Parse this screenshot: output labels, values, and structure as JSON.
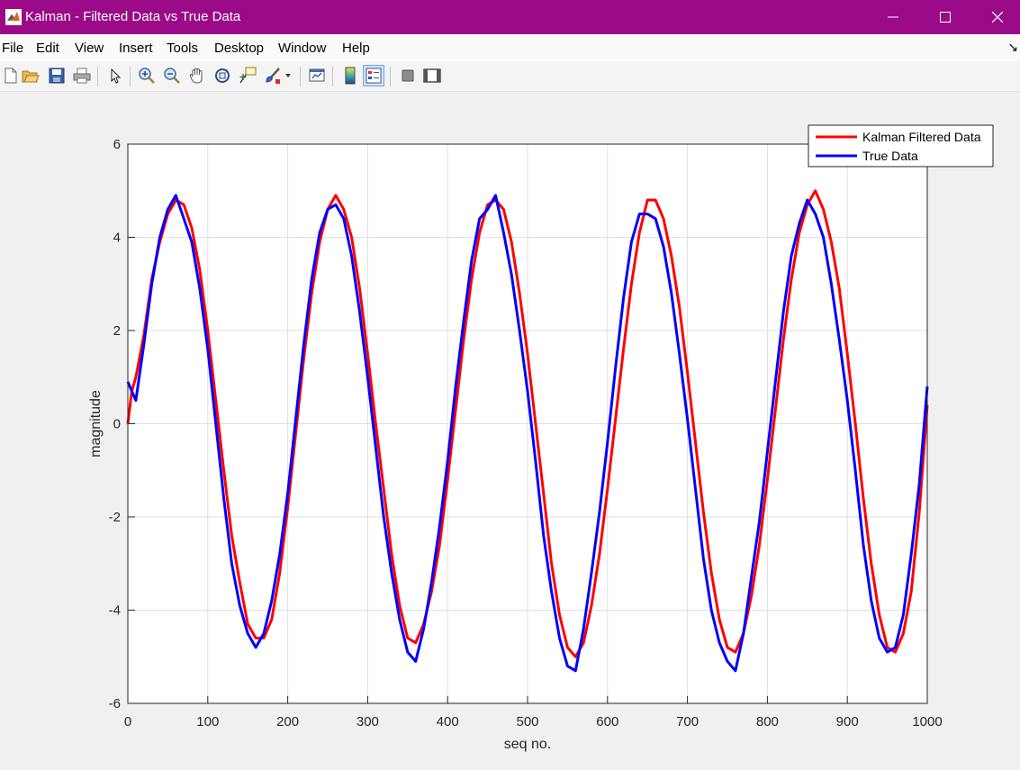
{
  "window": {
    "title": "Kalman - Filtered Data vs True Data",
    "titlebar_color": "#9b0a87",
    "controls": [
      "minimize-icon",
      "maximize-icon",
      "close-icon"
    ]
  },
  "menu": {
    "items": [
      "File",
      "Edit",
      "View",
      "Insert",
      "Tools",
      "Desktop",
      "Window",
      "Help"
    ]
  },
  "toolbar": {
    "icons": [
      "new-figure-icon",
      "open-file-icon",
      "save-icon",
      "print-icon",
      "select-pointer-icon",
      "zoom-in-icon",
      "zoom-out-icon",
      "pan-hand-icon",
      "rotate-3d-icon",
      "data-cursor-icon",
      "brush-icon",
      "link-plot-icon",
      "colorbar-icon",
      "legend-icon",
      "hide-plot-tools-icon",
      "show-plot-tools-icon"
    ]
  },
  "chart_data": {
    "type": "line",
    "title": "",
    "xlabel": "seq no.",
    "ylabel": "magnitude",
    "xlim": [
      0,
      1000
    ],
    "ylim": [
      -6,
      6
    ],
    "xticks": [
      0,
      100,
      200,
      300,
      400,
      500,
      600,
      700,
      800,
      900,
      1000
    ],
    "yticks": [
      -6,
      -4,
      -2,
      0,
      2,
      4,
      6
    ],
    "grid": true,
    "legend_position": "top-right",
    "series": [
      {
        "name": "Kalman Filtered Data",
        "color": "#ff0000",
        "x": [
          0,
          5,
          10,
          20,
          30,
          40,
          50,
          60,
          70,
          80,
          90,
          100,
          110,
          120,
          130,
          140,
          150,
          160,
          170,
          180,
          190,
          200,
          210,
          220,
          230,
          240,
          250,
          260,
          270,
          280,
          290,
          300,
          310,
          320,
          330,
          340,
          350,
          360,
          370,
          380,
          390,
          400,
          410,
          420,
          430,
          440,
          450,
          460,
          470,
          480,
          490,
          500,
          510,
          520,
          530,
          540,
          550,
          560,
          570,
          580,
          590,
          600,
          610,
          620,
          630,
          640,
          650,
          660,
          670,
          680,
          690,
          700,
          710,
          720,
          730,
          740,
          750,
          760,
          770,
          780,
          790,
          800,
          810,
          820,
          830,
          840,
          850,
          860,
          870,
          880,
          890,
          900,
          910,
          920,
          930,
          940,
          950,
          960,
          970,
          980,
          990,
          1000
        ],
        "y": [
          0.0,
          0.7,
          1.0,
          1.9,
          3.1,
          3.9,
          4.5,
          4.8,
          4.7,
          4.2,
          3.3,
          2.0,
          0.5,
          -1.0,
          -2.4,
          -3.4,
          -4.3,
          -4.6,
          -4.6,
          -4.2,
          -3.2,
          -1.8,
          -0.2,
          1.4,
          2.8,
          3.9,
          4.6,
          4.9,
          4.6,
          4.0,
          2.9,
          1.5,
          0.0,
          -1.4,
          -2.8,
          -3.9,
          -4.6,
          -4.7,
          -4.3,
          -3.6,
          -2.6,
          -1.2,
          0.3,
          1.8,
          3.1,
          4.1,
          4.7,
          4.8,
          4.6,
          3.9,
          2.8,
          1.5,
          0.0,
          -1.5,
          -3.0,
          -4.1,
          -4.8,
          -5.0,
          -4.7,
          -3.9,
          -2.8,
          -1.4,
          0.1,
          1.6,
          3.0,
          4.1,
          4.8,
          4.8,
          4.4,
          3.6,
          2.5,
          1.1,
          -0.4,
          -1.9,
          -3.2,
          -4.2,
          -4.8,
          -4.9,
          -4.5,
          -3.7,
          -2.6,
          -1.2,
          0.3,
          1.8,
          3.1,
          4.1,
          4.7,
          5.0,
          4.6,
          3.9,
          2.9,
          1.5,
          0.0,
          -1.6,
          -3.0,
          -4.1,
          -4.8,
          -4.9,
          -4.5,
          -3.6,
          -1.9,
          0.4
        ]
      },
      {
        "name": "True Data",
        "color": "#0000ff",
        "x": [
          0,
          5,
          10,
          20,
          30,
          40,
          50,
          60,
          70,
          80,
          90,
          100,
          110,
          120,
          130,
          140,
          150,
          160,
          170,
          180,
          190,
          200,
          210,
          220,
          230,
          240,
          250,
          260,
          270,
          280,
          290,
          300,
          310,
          320,
          330,
          340,
          350,
          360,
          370,
          380,
          390,
          400,
          410,
          420,
          430,
          440,
          450,
          460,
          470,
          480,
          490,
          500,
          510,
          520,
          530,
          540,
          550,
          560,
          570,
          580,
          590,
          600,
          610,
          620,
          630,
          640,
          650,
          660,
          670,
          680,
          690,
          700,
          710,
          720,
          730,
          740,
          750,
          760,
          770,
          780,
          790,
          800,
          810,
          820,
          830,
          840,
          850,
          860,
          870,
          880,
          890,
          900,
          910,
          920,
          930,
          940,
          950,
          960,
          970,
          980,
          990,
          1000
        ],
        "y": [
          0.9,
          0.7,
          0.5,
          1.7,
          3.0,
          4.0,
          4.6,
          4.9,
          4.4,
          3.9,
          2.9,
          1.6,
          0.0,
          -1.6,
          -3.0,
          -3.9,
          -4.5,
          -4.8,
          -4.5,
          -3.8,
          -2.8,
          -1.5,
          0.1,
          1.7,
          3.1,
          4.1,
          4.6,
          4.7,
          4.4,
          3.6,
          2.4,
          1.0,
          -0.5,
          -2.0,
          -3.2,
          -4.2,
          -4.9,
          -5.1,
          -4.4,
          -3.4,
          -2.2,
          -0.8,
          0.8,
          2.2,
          3.5,
          4.4,
          4.6,
          4.9,
          4.1,
          3.2,
          2.0,
          0.7,
          -0.8,
          -2.4,
          -3.6,
          -4.6,
          -5.2,
          -5.3,
          -4.4,
          -3.2,
          -1.9,
          -0.4,
          1.2,
          2.7,
          3.9,
          4.5,
          4.5,
          4.4,
          3.8,
          2.8,
          1.5,
          0.1,
          -1.4,
          -2.9,
          -4.0,
          -4.7,
          -5.1,
          -5.3,
          -4.5,
          -3.3,
          -2.1,
          -0.6,
          0.9,
          2.4,
          3.6,
          4.3,
          4.8,
          4.5,
          4.0,
          3.0,
          1.8,
          0.5,
          -1.0,
          -2.6,
          -3.8,
          -4.6,
          -4.9,
          -4.8,
          -4.1,
          -2.8,
          -1.3,
          0.8
        ]
      }
    ]
  }
}
